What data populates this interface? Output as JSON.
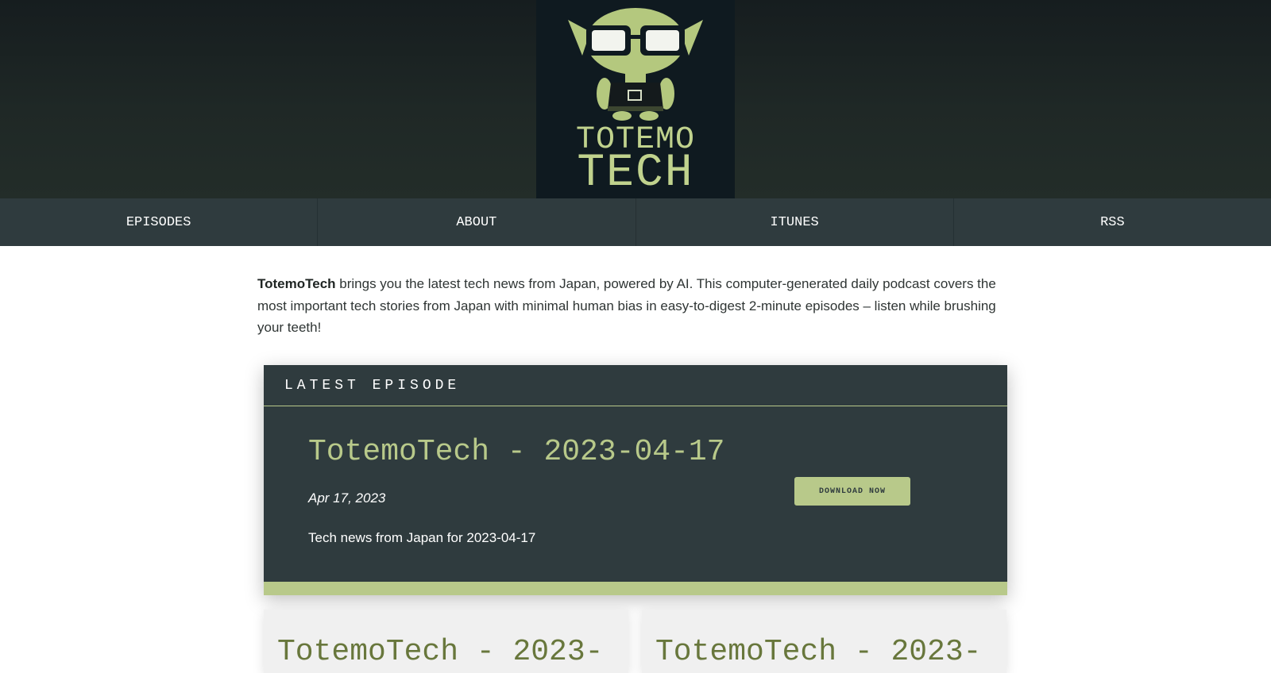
{
  "brand": {
    "logo_line1": "TOTEMO",
    "logo_line2": "TECH",
    "name": "TotemoTech"
  },
  "nav": {
    "items": [
      {
        "label": "EPISODES"
      },
      {
        "label": "ABOUT"
      },
      {
        "label": "ITUNES"
      },
      {
        "label": "RSS"
      }
    ]
  },
  "intro": {
    "text": "brings you the latest tech news from Japan, powered by AI. This computer-generated daily podcast covers the most important tech stories from Japan with minimal human bias in easy-to-digest 2-minute episodes – listen while brushing your teeth!"
  },
  "latest": {
    "heading": "LATEST EPISODE",
    "title": "TotemoTech - 2023-04-17",
    "date": "Apr 17, 2023",
    "description": "Tech news from Japan for 2023-04-17",
    "download_label": "DOWNLOAD NOW"
  },
  "episodes": [
    {
      "title": "TotemoTech - 2023-"
    },
    {
      "title": "TotemoTech - 2023-"
    }
  ],
  "colors": {
    "accent": "#b8c98a",
    "panel": "#2f3b3e",
    "header_bg": "#1f2826",
    "card_title": "#68773c"
  }
}
